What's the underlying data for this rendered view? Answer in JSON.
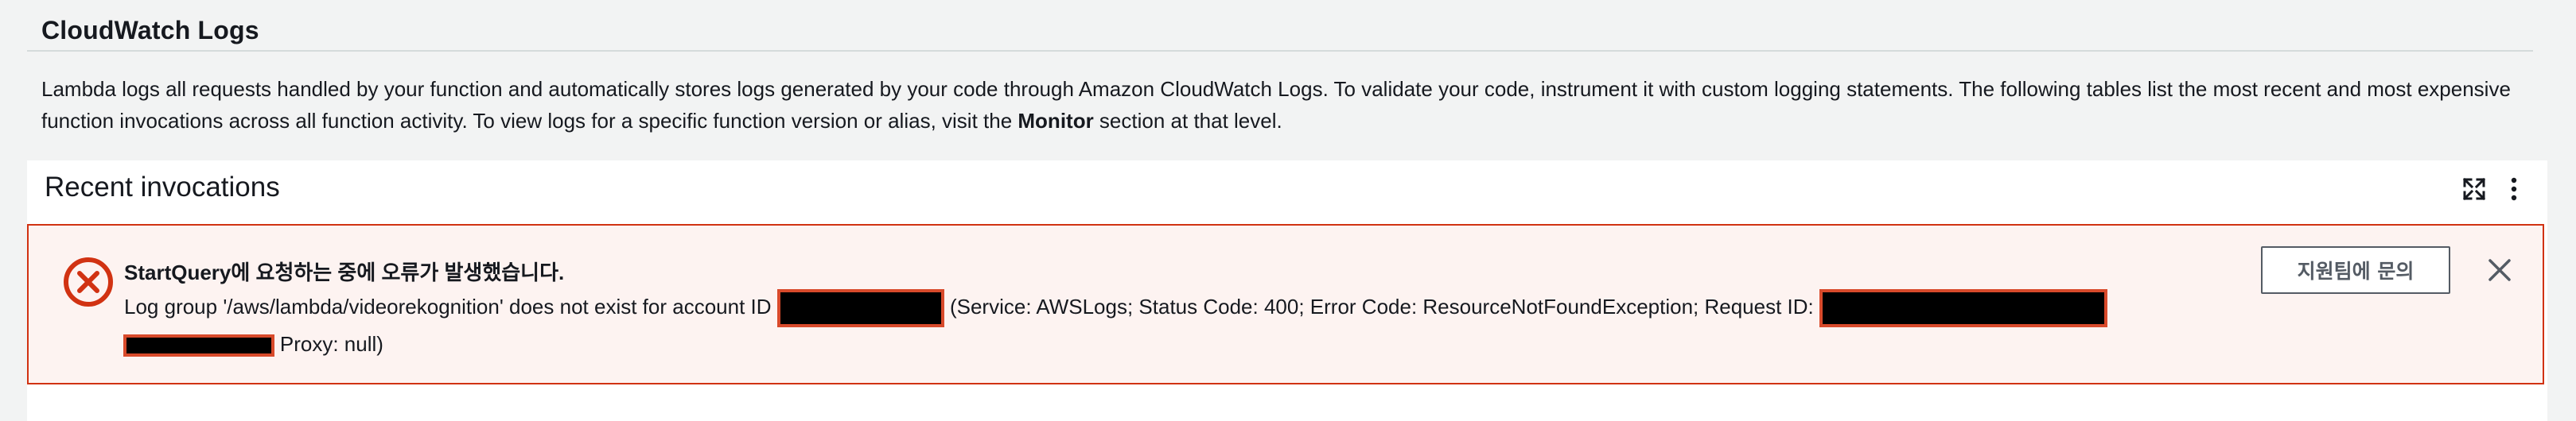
{
  "section": {
    "title": "CloudWatch Logs",
    "description_part1": "Lambda logs all requests handled by your function and automatically stores logs generated by your code through Amazon CloudWatch Logs. To validate your code, instrument it with custom logging statements. The following tables list the most recent and most expensive function invocations across all function activity. To view logs for a specific function version or alias, visit the ",
    "description_link": "Monitor",
    "description_part2": " section at that level."
  },
  "panel": {
    "title": "Recent invocations",
    "icons": [
      "expand-icon",
      "more-options-icon"
    ]
  },
  "alert": {
    "icon": "error-circle-icon",
    "heading": "StartQuery에 요청하는 중에 오류가 발생했습니다.",
    "text_part1": "Log group '/aws/lambda/videorekognition' does not exist for account ID ",
    "text_part2": " (Service: AWSLogs; Status Code: 400; Error Code: ResourceNotFoundException; Request ID: ",
    "text_part3": "(",
    "text_part4": " Proxy: null)",
    "support_button": "지원팀에 문의",
    "close_icon": "close-icon",
    "colors": {
      "border": "#d13212",
      "background": "#fdf3f1",
      "icon": "#d13212"
    }
  }
}
